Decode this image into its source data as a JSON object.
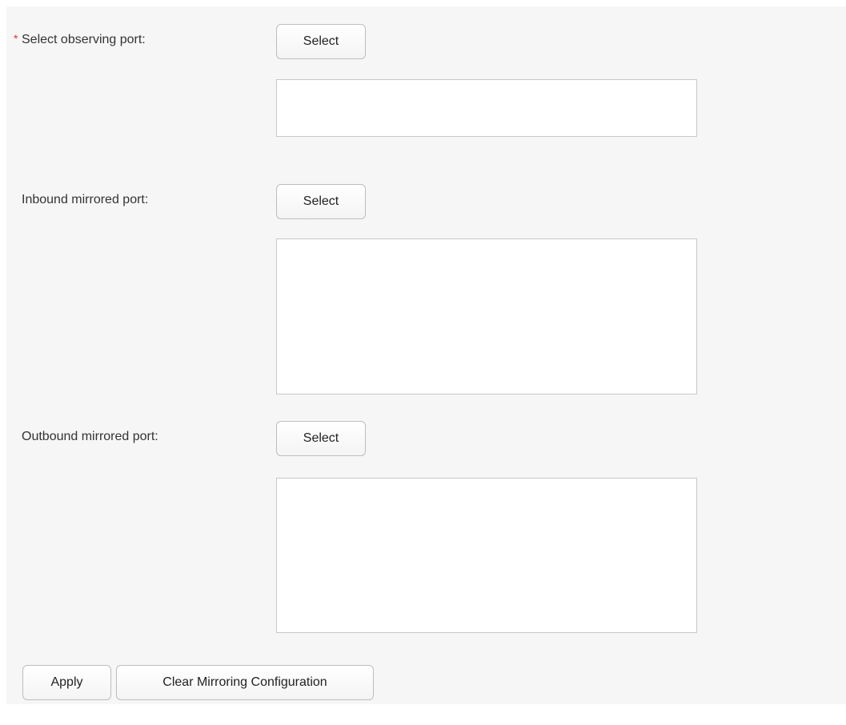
{
  "form": {
    "required_marker": "*",
    "observing": {
      "label": "Select observing port:",
      "select_label": "Select",
      "value": ""
    },
    "inbound": {
      "label": "Inbound mirrored port:",
      "select_label": "Select",
      "value": ""
    },
    "outbound": {
      "label": "Outbound mirrored port:",
      "select_label": "Select",
      "value": ""
    }
  },
  "actions": {
    "apply_label": "Apply",
    "clear_label": "Clear Mirroring Configuration"
  },
  "colors": {
    "panel_bg": "#f6f6f6",
    "required": "#e0322f"
  }
}
